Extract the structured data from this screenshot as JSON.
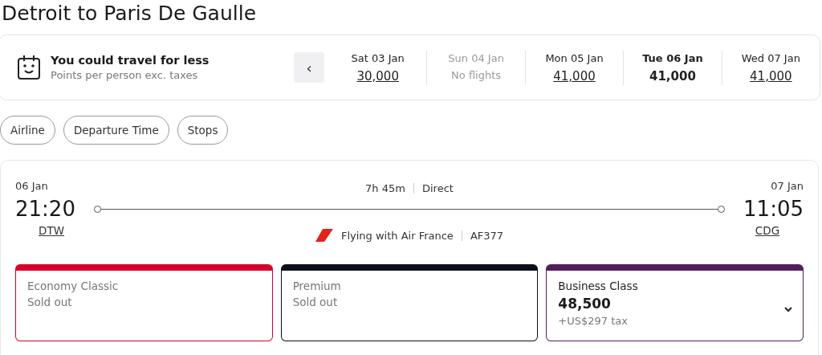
{
  "title": "Detroit to Paris De Gaulle",
  "promo": {
    "heading": "You could travel for less",
    "subtext": "Points per person exc. taxes"
  },
  "date_strip": {
    "prev": "‹",
    "dates": [
      {
        "label": "Sat 03 Jan",
        "value": "30,000",
        "selected": false,
        "disabled": false
      },
      {
        "label": "Sun 04 Jan",
        "value": "No flights",
        "selected": false,
        "disabled": true
      },
      {
        "label": "Mon 05 Jan",
        "value": "41,000",
        "selected": false,
        "disabled": false
      },
      {
        "label": "Tue 06 Jan",
        "value": "41,000",
        "selected": true,
        "disabled": false
      },
      {
        "label": "Wed 07 Jan",
        "value": "41,000",
        "selected": false,
        "disabled": false
      }
    ]
  },
  "filters": [
    "Airline",
    "Departure Time",
    "Stops"
  ],
  "flight": {
    "depart_date": "06 Jan",
    "depart_time": "21:20",
    "depart_airport": "DTW",
    "duration": "7h 45m",
    "stops": "Direct",
    "operator": "Flying with Air France",
    "flight_number": "AF377",
    "arrive_date": "07 Jan",
    "arrive_time": "11:05",
    "arrive_airport": "CDG"
  },
  "fares": [
    {
      "kind": "sold_out",
      "name": "Economy Classic",
      "status": "Sold out",
      "color": "#d6002a"
    },
    {
      "kind": "sold_out",
      "name": "Premium",
      "status": "Sold out",
      "color": "#0b0f1a"
    },
    {
      "kind": "available",
      "name": "Business Class",
      "price": "48,500",
      "tax": "+US$297 tax",
      "color": "#531d5e"
    }
  ]
}
